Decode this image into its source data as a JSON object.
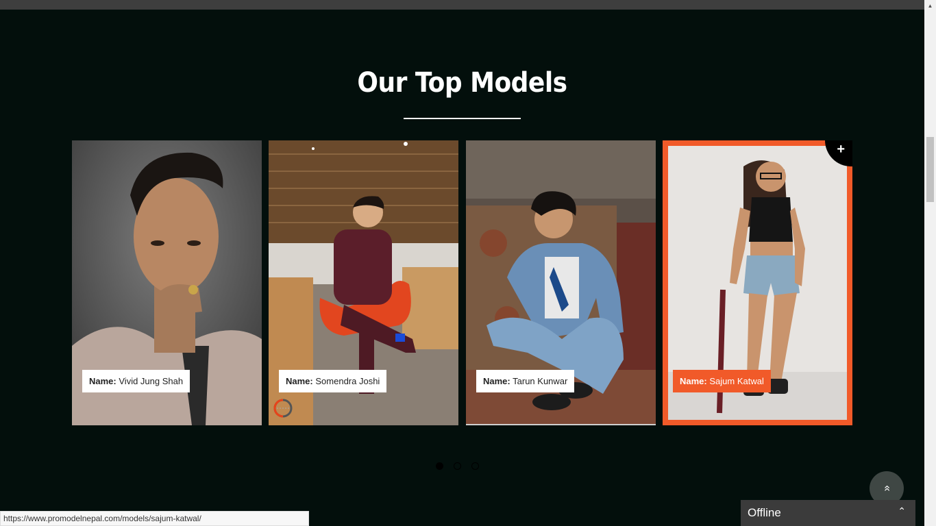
{
  "section": {
    "title": "Our Top Models"
  },
  "models": [
    {
      "label": "Name:",
      "name": "Vivid Jung Shah"
    },
    {
      "label": "Name:",
      "name": "Somendra Joshi"
    },
    {
      "label": "Name:",
      "name": "Tarun Kunwar"
    },
    {
      "label": "Name:",
      "name": "Sajum Katwal"
    }
  ],
  "card_overlay": {
    "plus": "+"
  },
  "carousel": {
    "pages": 3,
    "active_page": 1
  },
  "back_to_top": {
    "icon": "«"
  },
  "chat": {
    "status": "Offline",
    "toggle_icon": "chevron-up-icon"
  },
  "status_bar": {
    "url": "https://www.promodelnepal.com/models/sajum-katwal/"
  },
  "colors": {
    "accent": "#f15a29",
    "background": "#030f0c",
    "title": "#ffffff"
  }
}
